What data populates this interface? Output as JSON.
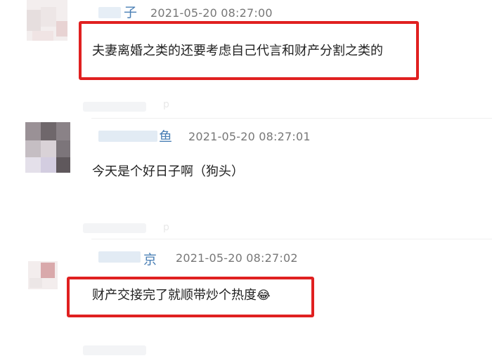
{
  "comments": [
    {
      "name_fragment": "子",
      "time": "2021-05-20 08:27:00",
      "text": "夫妻离婚之类的还要考虑自己代言和财产分割之类的",
      "highlighted": true
    },
    {
      "name_fragment": "鱼",
      "time": "2021-05-20 08:27:01",
      "text": "今天是个好日子啊（狗头）",
      "highlighted": false
    },
    {
      "name_fragment": "京",
      "time": "2021-05-20 08:27:02",
      "text": "财产交接完了就顺带炒个热度",
      "emoji": "😂",
      "highlighted": true
    }
  ],
  "ghost_action": "p",
  "colors": {
    "highlight": "#e02020",
    "name": "#4a7fb5",
    "time": "#777777",
    "text": "#222222"
  }
}
